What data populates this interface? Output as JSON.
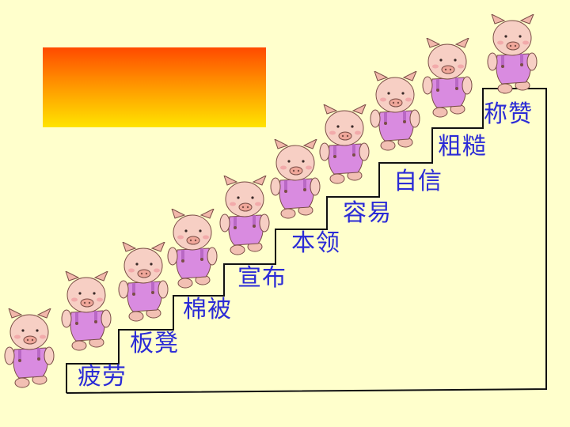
{
  "slide": {
    "words": [
      "疲劳",
      "板凳",
      "棉被",
      "宣布",
      "本领",
      "容易",
      "自信",
      "粗糙",
      "称赞"
    ],
    "pig_count": 10,
    "colors": {
      "background": "#ffffcc",
      "word": "#2b2bd6",
      "pig_skin": "#f7cfc4",
      "pig_overalls": "#d98be0",
      "stair_line": "#111111"
    },
    "icons": [
      "pig-cartoon-icon"
    ]
  }
}
